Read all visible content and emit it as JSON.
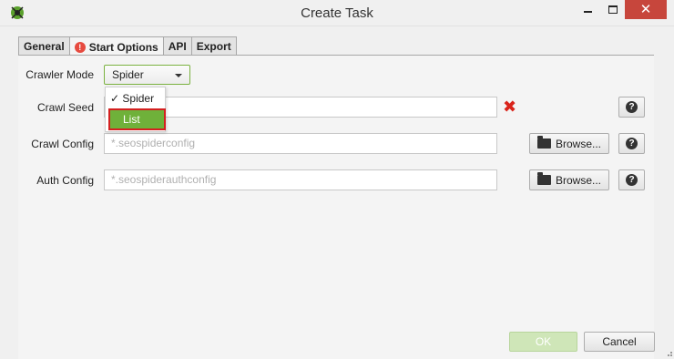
{
  "window": {
    "title": "Create Task",
    "minimize_glyph": "",
    "close_glyph": "✕"
  },
  "tabs": [
    {
      "label": "General"
    },
    {
      "label": "Start Options",
      "icon": "warning-icon",
      "active": true
    },
    {
      "label": "API"
    },
    {
      "label": "Export"
    }
  ],
  "form": {
    "crawler_mode": {
      "label": "Crawler Mode",
      "value": "Spider",
      "options": [
        "Spider",
        "List"
      ],
      "checked": "Spider",
      "highlighted": "List"
    },
    "crawl_seed": {
      "label": "Crawl Seed",
      "value": "",
      "error_icon": "red-x-icon"
    },
    "crawl_config": {
      "label": "Crawl Config",
      "placeholder": "*.seospiderconfig",
      "browse": "Browse..."
    },
    "auth_config": {
      "label": "Auth Config",
      "placeholder": "*.seospiderauthconfig",
      "browse": "Browse..."
    }
  },
  "dropdown": {
    "spider": "✓ Spider",
    "list": "List"
  },
  "footer": {
    "ok": "OK",
    "cancel": "Cancel"
  },
  "colors": {
    "accent_green": "#6fb13a",
    "error_red": "#d9241b",
    "close_red": "#c7463c"
  }
}
